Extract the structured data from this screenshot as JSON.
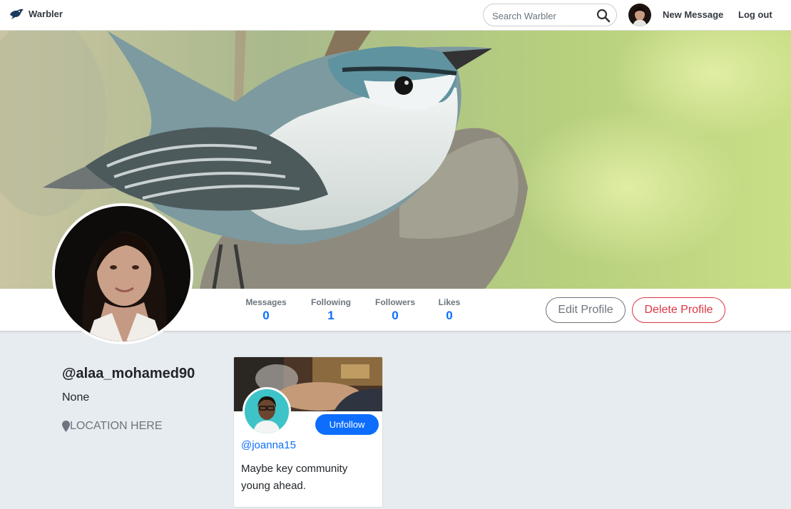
{
  "nav": {
    "brand": "Warbler",
    "search_placeholder": "Search Warbler",
    "new_message": "New Message",
    "logout": "Log out"
  },
  "profile": {
    "username": "@alaa_mohamed90",
    "bio": "None",
    "location": "LOCATION HERE"
  },
  "stats": [
    {
      "label": "Messages",
      "value": "0"
    },
    {
      "label": "Following",
      "value": "1"
    },
    {
      "label": "Followers",
      "value": "0"
    },
    {
      "label": "Likes",
      "value": "0"
    }
  ],
  "actions": {
    "edit": "Edit Profile",
    "delete": "Delete Profile"
  },
  "following_card": {
    "username": "@joanna15",
    "bio": "Maybe key community young ahead.",
    "unfollow": "Unfollow"
  },
  "colors": {
    "primary": "#0d6efd",
    "danger": "#dc3545",
    "page_bg": "#e6ecf0"
  }
}
